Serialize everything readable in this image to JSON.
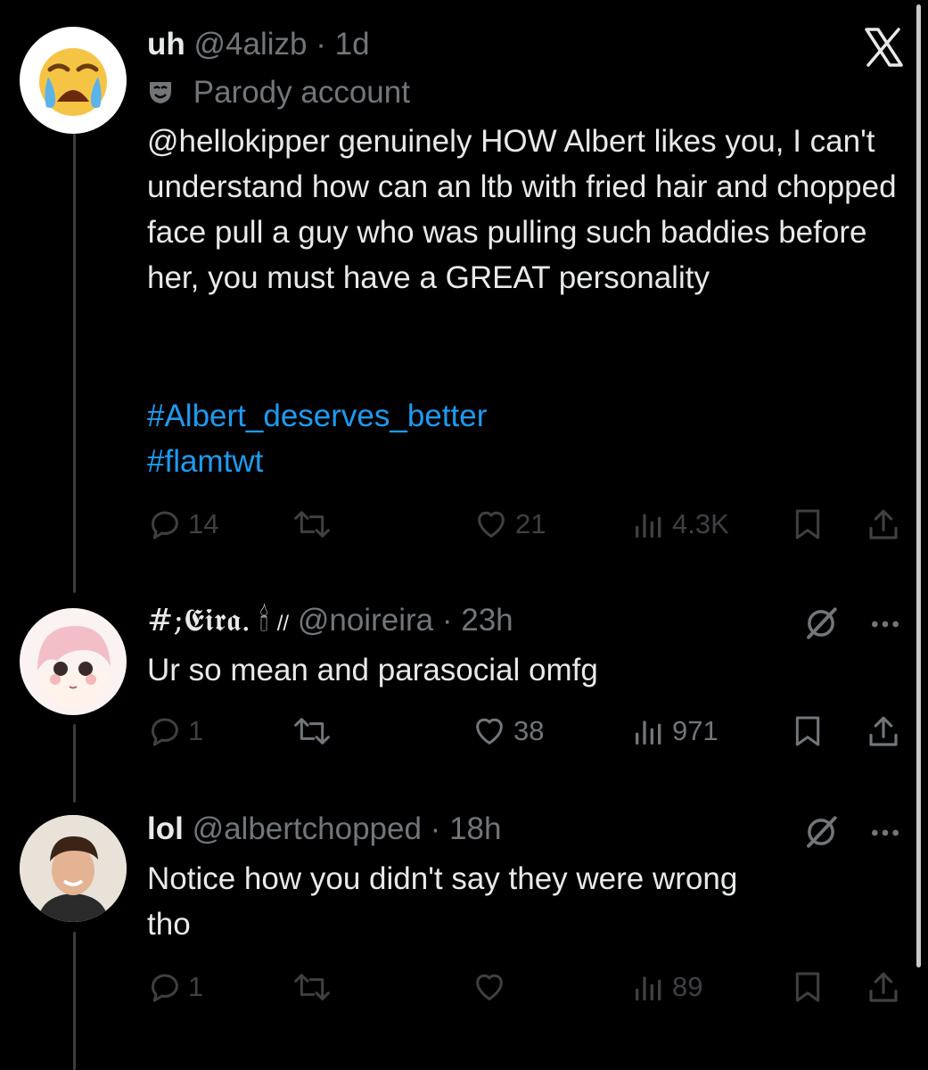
{
  "tweets": [
    {
      "display_name": "uh",
      "handle": "@4alizb",
      "sep": "·",
      "time": "1d",
      "badge": "Parody account",
      "text": "@hellokipper genuinely HOW Albert likes you, I can't understand how can an ltb with fried hair and chopped face pull a guy who was pulling such baddies before her, you must have a GREAT personality",
      "hashtags": [
        "#Albert_deserves_better",
        "#flamtwt"
      ],
      "replies": "14",
      "likes": "21",
      "views": "4.3K"
    },
    {
      "display_name": "#;𝕰𝖎𝖗𝖆.",
      "name_emoji": "🕯",
      "name_suffix": "//",
      "handle": "@noireira",
      "sep": "·",
      "time": "23h",
      "text": "Ur so mean and parasocial omfg",
      "replies": "1",
      "likes": "38",
      "views": "971"
    },
    {
      "display_name": "lol",
      "handle": "@albertchopped",
      "sep": "·",
      "time": "18h",
      "text": "Notice how you didn't say they were wrong\ntho",
      "replies": "1",
      "likes": "",
      "views": "89"
    }
  ],
  "colors": {
    "background": "#000000",
    "text": "#e7e9ea",
    "muted": "#71767b",
    "link": "#1d9bf0"
  },
  "icons": [
    "x-logo-icon",
    "parody-mask-icon",
    "reply-icon",
    "retweet-icon",
    "like-icon",
    "views-icon",
    "bookmark-icon",
    "share-icon",
    "grok-icon",
    "more-icon"
  ]
}
